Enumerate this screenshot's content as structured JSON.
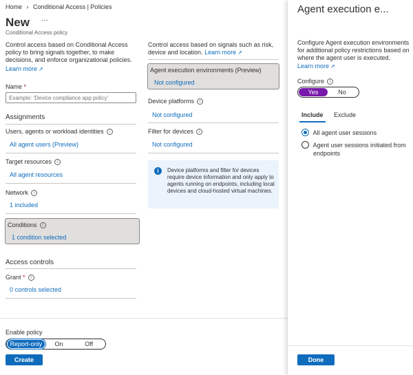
{
  "breadcrumb": {
    "home": "Home",
    "sep": "›",
    "policies": "Conditional Access | Policies"
  },
  "header": {
    "title": "New",
    "more": "···",
    "subtitle": "Conditional Access policy"
  },
  "left": {
    "intro": "Control access based on Conditional Access policy to bring signals together, to make decisions, and enforce organizational policies.",
    "learn_more": "Learn more",
    "name_label": "Name",
    "name_required": "*",
    "name_placeholder": "Example: 'Device compliance app policy'",
    "assignments": "Assignments",
    "users_label": "Users, agents or workload identities",
    "users_value": "All agent users (Preview)",
    "target_label": "Target resources",
    "target_value": "All agent resources",
    "network_label": "Network",
    "network_value": "1 included",
    "conditions_label": "Conditions",
    "conditions_value": "1 condition selected",
    "access_controls": "Access controls",
    "grant_label": "Grant",
    "grant_required": "*",
    "grant_value": "0 controls selected"
  },
  "middle": {
    "intro": "Control access based on signals such as risk, device and location.",
    "learn_more": "Learn more",
    "agent_env_label": "Agent execution environments (Preview)",
    "agent_env_value": "Not configured",
    "device_label": "Device platforms",
    "device_value": "Not configured",
    "filter_label": "Filter for devices",
    "filter_value": "Not configured",
    "info_text": "Device platforms and filter for devices require device information and only apply to agents running on endpoints, including local devices and cloud-hosted virtual machines."
  },
  "footer": {
    "enable_label": "Enable policy",
    "options": [
      "Report-only",
      "On",
      "Off"
    ],
    "selected": "Report-only",
    "create": "Create"
  },
  "panel": {
    "title": "Agent execution e...",
    "description": "Configure Agent execution environments for additional policy restrictions based on where the agent user is executed.",
    "learn_more": "Learn more",
    "configure_label": "Configure",
    "yes": "Yes",
    "no": "No",
    "tab_include": "Include",
    "tab_exclude": "Exclude",
    "radio_all": "All agent user sessions",
    "radio_endpoints_1": "Agent user sessions initiated from",
    "radio_endpoints_2": "endpoints",
    "done": "Done"
  },
  "colors": {
    "accent": "#0f6cbd",
    "toggle_purple": "#7719aa",
    "box_gray": "#e1dfdd"
  }
}
